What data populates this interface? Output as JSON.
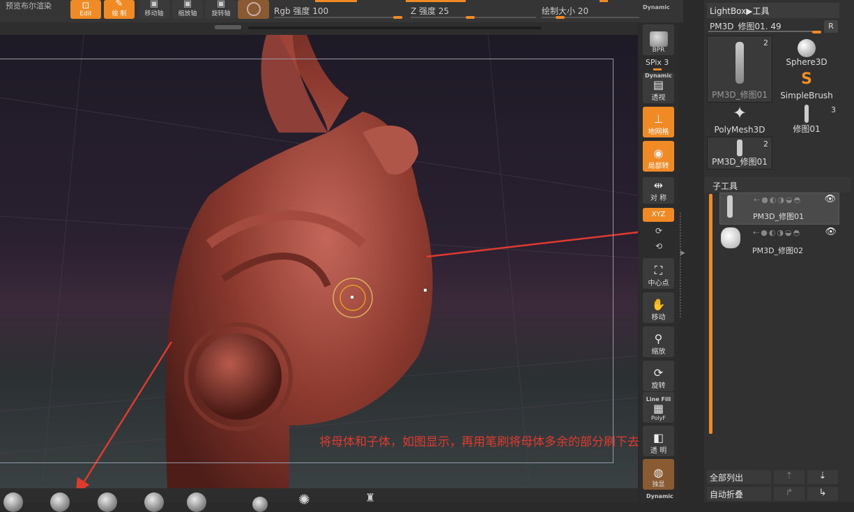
{
  "topbar": {
    "preview_label": "预览布尔渲染",
    "edit_label": "Edit",
    "draw_label": "绘 制",
    "move_label": "移动轴",
    "scale_label": "缩放轴",
    "rotate_label": "旋转轴",
    "rgb_label": "Rgb 强度",
    "rgb_value": "100",
    "z_label": "Z 强度",
    "z_value": "25",
    "draw_size_label": "绘制大小",
    "draw_size_value": "20",
    "dynamic_label": "Dynamic"
  },
  "right_toolbar": {
    "bpr_label": "BPR",
    "spix_label": "SPix 3",
    "dynamic_small": "Dynamic",
    "perspective_label": "透视",
    "floor_label": "地网格",
    "local_label": "局部转",
    "symmetry_label": "对 称",
    "xyz_label": "XYZ",
    "center_label": "中心点",
    "move_label": "移动",
    "zoom_label": "缩放",
    "rotate_label": "旋转",
    "linefill_label": "Line Fill",
    "polyf_label": "PolyF",
    "transp_label": "透 明",
    "solo_label": "独显",
    "dynamic_bottom": "Dynamic"
  },
  "tool_panel": {
    "lightbox_label": "LightBox▶工具",
    "current_tool": "PM3D_修图01. 49",
    "r_button": "R",
    "tools": [
      {
        "name": "PM3D_修图01",
        "count": "2"
      },
      {
        "name": "Sphere3D",
        "count": ""
      },
      {
        "name": "SimpleBrush",
        "count": ""
      },
      {
        "name": "PolyMesh3D",
        "count": ""
      },
      {
        "name": "修图01",
        "count": "3"
      },
      {
        "name": "PM3D_修图01",
        "count": "2"
      }
    ]
  },
  "subtool": {
    "title": "子工具",
    "items": [
      {
        "name": "PM3D_修图01",
        "selected": true
      },
      {
        "name": "PM3D_修图02",
        "selected": false
      }
    ],
    "list_all_label": "全部列出",
    "auto_collapse_label": "自动折叠"
  },
  "canvas": {
    "annotation_text": "将母体和子体，如图显示，再用笔刷将母体多余的部分刷下去。"
  },
  "colors": {
    "accent": "#f08a24",
    "annotation": "#e03a2e",
    "model": "#8a3a2e"
  }
}
